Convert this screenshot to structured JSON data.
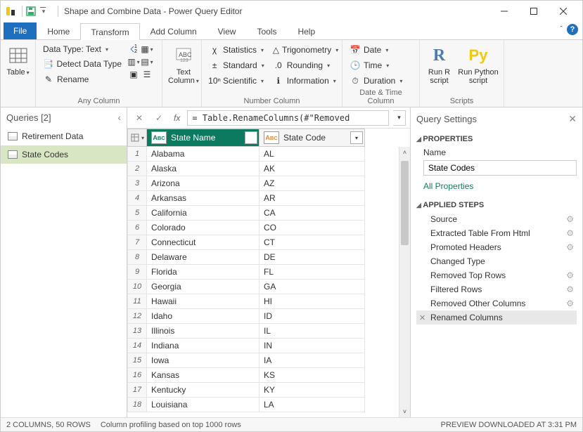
{
  "titlebar": {
    "title": "Shape and Combine Data - Power Query Editor"
  },
  "tabs": {
    "file": "File",
    "home": "Home",
    "transform": "Transform",
    "addcolumn": "Add Column",
    "view": "View",
    "tools": "Tools",
    "help": "Help"
  },
  "ribbon": {
    "table_label": "Table",
    "anycol_group": "Any Column",
    "datatype": "Data Type: Text",
    "detect": "Detect Data Type",
    "rename": "Rename",
    "textcol_label": "Text\nColumn",
    "numcol_group": "Number Column",
    "statistics": "Statistics",
    "standard": "Standard",
    "scientific": "Scientific",
    "trig": "Trigonometry",
    "rounding": "Rounding",
    "information": "Information",
    "dtcol_group": "Date & Time Column",
    "date": "Date",
    "time": "Time",
    "duration": "Duration",
    "scripts_group": "Scripts",
    "runr": "Run R\nscript",
    "runpy": "Run Python\nscript"
  },
  "queries": {
    "header": "Queries [2]",
    "items": [
      "Retirement Data",
      "State Codes"
    ]
  },
  "fx": {
    "formula": "= Table.RenameColumns(#\"Removed"
  },
  "grid": {
    "col1": "State Name",
    "col2": "State Code",
    "rows": [
      {
        "n": "1",
        "name": "Alabama",
        "code": "AL"
      },
      {
        "n": "2",
        "name": "Alaska",
        "code": "AK"
      },
      {
        "n": "3",
        "name": "Arizona",
        "code": "AZ"
      },
      {
        "n": "4",
        "name": "Arkansas",
        "code": "AR"
      },
      {
        "n": "5",
        "name": "California",
        "code": "CA"
      },
      {
        "n": "6",
        "name": "Colorado",
        "code": "CO"
      },
      {
        "n": "7",
        "name": "Connecticut",
        "code": "CT"
      },
      {
        "n": "8",
        "name": "Delaware",
        "code": "DE"
      },
      {
        "n": "9",
        "name": "Florida",
        "code": "FL"
      },
      {
        "n": "10",
        "name": "Georgia",
        "code": "GA"
      },
      {
        "n": "11",
        "name": "Hawaii",
        "code": "HI"
      },
      {
        "n": "12",
        "name": "Idaho",
        "code": "ID"
      },
      {
        "n": "13",
        "name": "Illinois",
        "code": "IL"
      },
      {
        "n": "14",
        "name": "Indiana",
        "code": "IN"
      },
      {
        "n": "15",
        "name": "Iowa",
        "code": "IA"
      },
      {
        "n": "16",
        "name": "Kansas",
        "code": "KS"
      },
      {
        "n": "17",
        "name": "Kentucky",
        "code": "KY"
      },
      {
        "n": "18",
        "name": "Louisiana",
        "code": "LA"
      }
    ]
  },
  "settings": {
    "header": "Query Settings",
    "properties": "PROPERTIES",
    "name_label": "Name",
    "name_value": "State Codes",
    "all_properties": "All Properties",
    "applied_steps": "APPLIED STEPS",
    "steps": [
      {
        "label": "Source",
        "gear": true
      },
      {
        "label": "Extracted Table From Html",
        "gear": true
      },
      {
        "label": "Promoted Headers",
        "gear": true
      },
      {
        "label": "Changed Type",
        "gear": false
      },
      {
        "label": "Removed Top Rows",
        "gear": true
      },
      {
        "label": "Filtered Rows",
        "gear": true
      },
      {
        "label": "Removed Other Columns",
        "gear": true
      },
      {
        "label": "Renamed Columns",
        "gear": false
      }
    ]
  },
  "status": {
    "cols": "2 COLUMNS, 50 ROWS",
    "profiling": "Column profiling based on top 1000 rows",
    "preview": "PREVIEW DOWNLOADED AT 3:31 PM"
  }
}
